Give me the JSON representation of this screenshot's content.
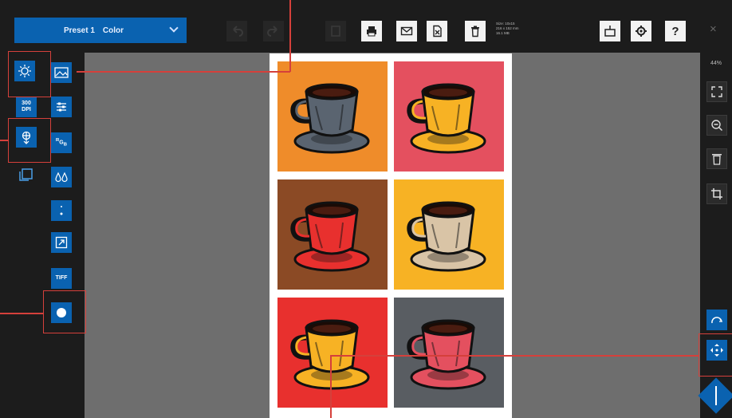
{
  "preset": {
    "label": "Preset 1",
    "mode": "Color"
  },
  "size_info": {
    "line1": "Size: 10x15",
    "line2": "216 x 152 mm",
    "line3": "16.1 MB"
  },
  "toolbar": {
    "help_label": "?",
    "close_label": "×"
  },
  "left_tools": {
    "dpi_value": "300",
    "dpi_unit": "DPI",
    "rgb_r": "R",
    "rgb_g": "G",
    "rgb_b": "B",
    "tiff_label": "TIFF"
  },
  "zoom": {
    "label": "44%"
  },
  "colors": {
    "accent": "#0a62b0",
    "callout": "#d5403b",
    "workspace": "#6e6e6e"
  },
  "tiles": [
    {
      "bg": "#ef8c2a",
      "cup": "#5a6470"
    },
    {
      "bg": "#e4505f",
      "cup": "#f7b224"
    },
    {
      "bg": "#8b4a25",
      "cup": "#e8302e"
    },
    {
      "bg": "#f7b224",
      "cup": "#d9c4a6"
    },
    {
      "bg": "#e8302e",
      "cup": "#f7b224"
    },
    {
      "bg": "#595d62",
      "cup": "#e4505f"
    }
  ]
}
